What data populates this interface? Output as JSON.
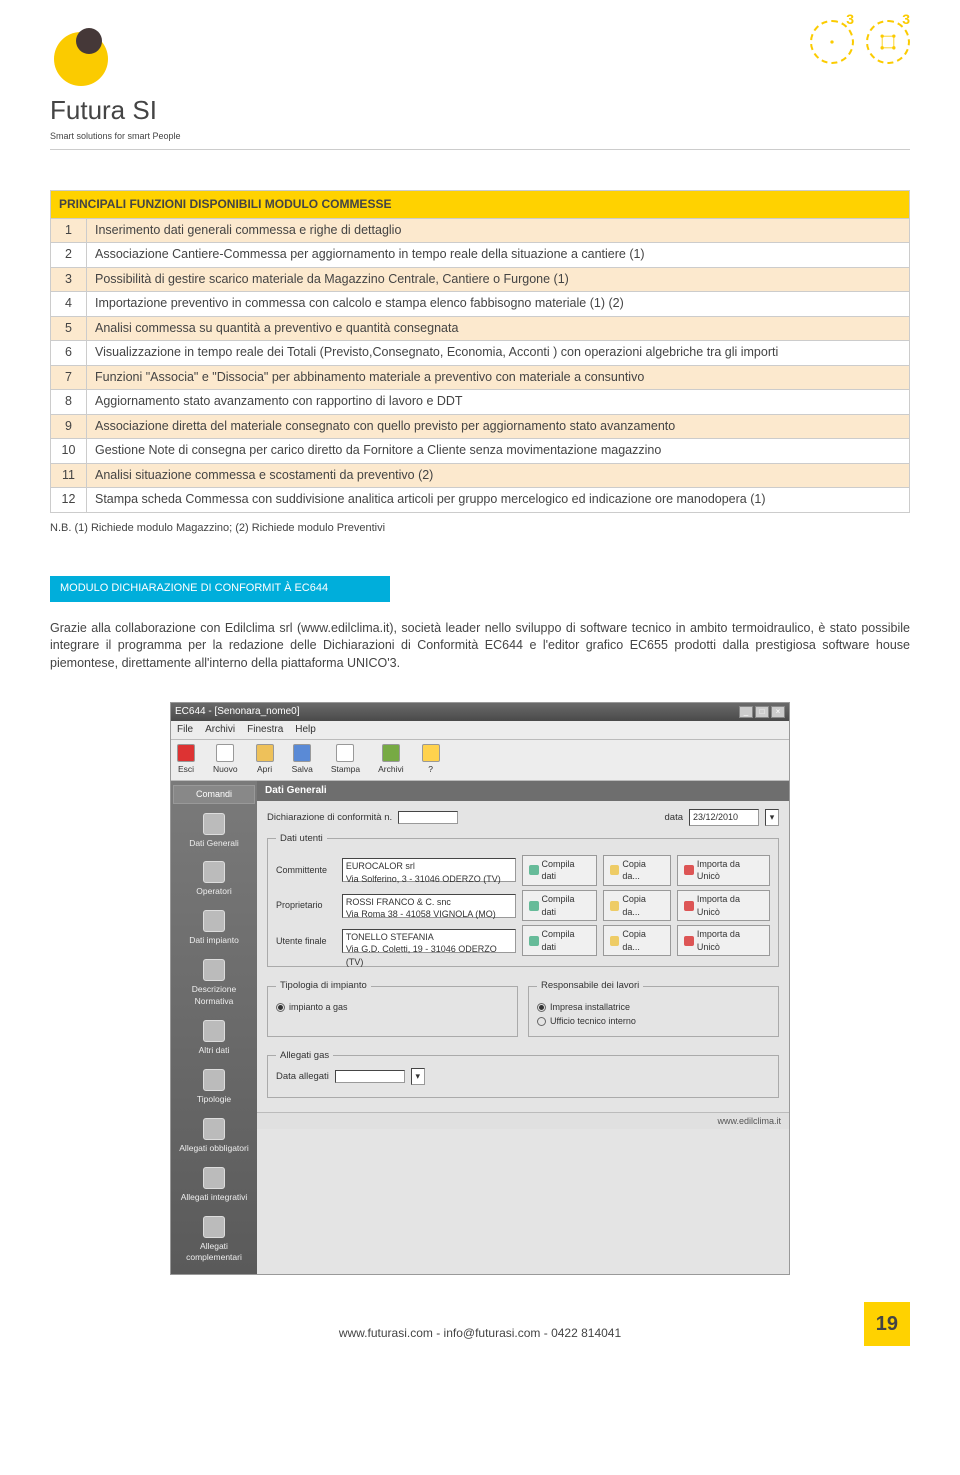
{
  "brand": {
    "name": "Futura SI",
    "tagline": "Smart solutions for smart People"
  },
  "topicons": {
    "num1": "3",
    "num2": "3"
  },
  "table": {
    "header": "PRINCIPALI FUNZIONI DISPONIBILI MODULO COMMESSE",
    "rows": [
      {
        "n": "1",
        "t": "Inserimento dati generali commessa e righe di dettaglio"
      },
      {
        "n": "2",
        "t": "Associazione Cantiere-Commessa per aggiornamento in tempo reale della situazione a cantiere (1)"
      },
      {
        "n": "3",
        "t": "Possibilità di gestire scarico materiale da Magazzino Centrale, Cantiere o Furgone (1)"
      },
      {
        "n": "4",
        "t": "Importazione preventivo in commessa con calcolo e stampa elenco fabbisogno materiale (1) (2)"
      },
      {
        "n": "5",
        "t": "Analisi commessa su quantità a preventivo e quantità consegnata"
      },
      {
        "n": "6",
        "t": "Visualizzazione in tempo reale dei Totali (Previsto,Consegnato, Economia, Acconti ) con operazioni algebriche tra gli importi"
      },
      {
        "n": "7",
        "t": "Funzioni \"Associa\" e \"Dissocia\" per abbinamento materiale a preventivo con materiale a consuntivo"
      },
      {
        "n": "8",
        "t": "Aggiornamento stato avanzamento con rapportino di lavoro e DDT"
      },
      {
        "n": "9",
        "t": "Associazione diretta del materiale consegnato con quello previsto per aggiornamento stato avanzamento"
      },
      {
        "n": "10",
        "t": "Gestione Note di consegna per carico diretto da Fornitore a Cliente senza movimentazione magazzino"
      },
      {
        "n": "11",
        "t": "Analisi situazione commessa e scostamenti da preventivo (2)"
      },
      {
        "n": "12",
        "t": "Stampa scheda Commessa con suddivisione analitica articoli per gruppo mercelogico ed indicazione ore manodopera (1)"
      }
    ]
  },
  "note": "N.B. (1) Richiede modulo Magazzino; (2) Richiede modulo Preventivi",
  "module_bar": "MODULO DICHIARAZIONE DI CONFORMIT À EC644",
  "body_text": "Grazie alla collaborazione con Edilclima srl (www.edilclima.it), società leader nello sviluppo di software tecnico in ambito termoidraulico, è stato possibile integrare il programma per la redazione delle Dichiarazioni di Conformità EC644 e l'editor grafico EC655 prodotti dalla prestigiosa software house piemontese, direttamente all'interno della piattaforma UNICO'3.",
  "shot": {
    "title": "EC644 - [Senonara_nome0]",
    "menu": {
      "file": "File",
      "archivi": "Archivi",
      "finestra": "Finestra",
      "help": "Help"
    },
    "toolbar": {
      "esci": "Esci",
      "nuovo": "Nuovo",
      "apri": "Apri",
      "salva": "Salva",
      "stampa": "Stampa",
      "archivi": "Archivi",
      "help": "?"
    },
    "side": {
      "header": "Comandi",
      "items": [
        "Dati Generali",
        "Operatori",
        "Dati impianto",
        "Descrizione Normativa",
        "Altri dati",
        "Tipologie",
        "Allegati obbligatori",
        "Allegati integrativi",
        "Allegati complementari"
      ]
    },
    "main": {
      "title": "Dati Generali",
      "decl_lbl": "Dichiarazione di conformità n.",
      "date_lbl": "data",
      "date_val": "23/12/2010",
      "utenti_legend": "Dati utenti",
      "rows": [
        {
          "lbl": "Committente",
          "val": "EUROCALOR srl\nVia Solferino, 3 - 31046 ODERZO (TV)"
        },
        {
          "lbl": "Proprietario",
          "val": "ROSSI FRANCO & C. snc\nVia Roma 38 - 41058 VIGNOLA (MO)"
        },
        {
          "lbl": "Utente finale",
          "val": "TONELLO STEFANIA\nVia G.D. Coletti, 19 - 31046 ODERZO (TV)"
        }
      ],
      "btn_compila": "Compila dati",
      "btn_copia": "Copia da...",
      "btn_importa": "Importa da Unicò",
      "tipologia_legend": "Tipologia di impianto",
      "tipologia_opt": "impianto a gas",
      "resp_legend": "Responsabile dei lavori",
      "resp_opt1": "Impresa installatrice",
      "resp_opt2": "Ufficio tecnico interno",
      "allegati_legend": "Allegati gas",
      "allegati_lbl": "Data allegati",
      "footer": "www.edilclima.it"
    }
  },
  "footer": {
    "text": "www.futurasi.com - info@futurasi.com - 0422 814041",
    "page": "19"
  }
}
